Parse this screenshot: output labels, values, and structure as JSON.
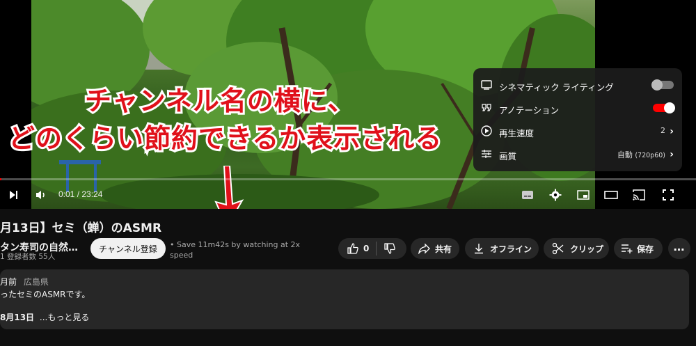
{
  "player": {
    "time_current": "0:01",
    "time_total": "23:24",
    "time_display": "0:01 / 23:24",
    "progress": 0.001,
    "settings_menu": {
      "items": [
        {
          "label": "シネマティック ライティング",
          "type": "toggle",
          "on": false
        },
        {
          "label": "アノテーション",
          "type": "toggle",
          "on": true
        },
        {
          "label": "再生速度",
          "type": "submenu",
          "value": "2"
        },
        {
          "label": "画質",
          "type": "submenu",
          "value": "自動",
          "value_detail": "(720p60)"
        }
      ]
    }
  },
  "annotation": {
    "line1": "チャンネル名の横に、",
    "line2": "どのくらい節約できるか表示される"
  },
  "video": {
    "title": "月13日】セミ（蝉）のASMR",
    "channel_name": "タン寿司の自然…",
    "subscribers": "1 登録者数 55人",
    "subscribe_label": "チャンネル登録",
    "save_note": "• Save 11m42s by watching at 2x speed"
  },
  "actions": {
    "likes": "0",
    "share": "共有",
    "offline": "オフライン",
    "clip": "クリップ",
    "save": "保存"
  },
  "description": {
    "meta_date": "月前",
    "meta_place": "広島県",
    "line1": "ったセミのASMRです。",
    "line3_date": "8月13日",
    "more": "...もっと見る"
  },
  "colors": {
    "accent_red": "#ff0000",
    "annotation_red": "#e0101a",
    "toggle_on": "#ff0000",
    "background": "#0f0f0f"
  }
}
